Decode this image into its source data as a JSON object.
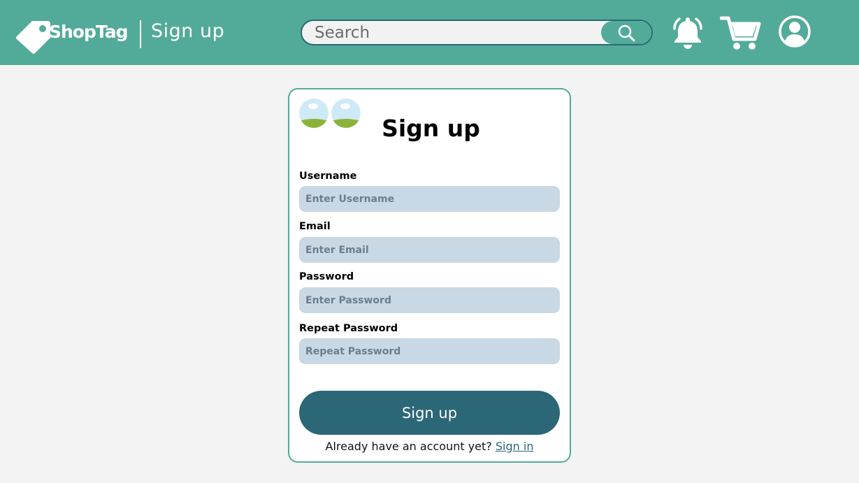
{
  "header": {
    "brand": "ShopTag",
    "page_label": "Sign up",
    "search": {
      "placeholder": "Search"
    },
    "icons": [
      "tag-logo-icon",
      "search-icon",
      "bell-icon",
      "cart-icon",
      "user-account-icon"
    ]
  },
  "form": {
    "title": "Sign up",
    "fields": [
      {
        "label": "Username",
        "placeholder": "Enter Username",
        "value": ""
      },
      {
        "label": "Email",
        "placeholder": "Enter Email",
        "value": ""
      },
      {
        "label": "Password",
        "placeholder": "Enter Password",
        "value": ""
      },
      {
        "label": "Repeat Password",
        "placeholder": "Repeat Password",
        "value": ""
      }
    ],
    "submit_label": "Sign up",
    "footer_text": "Already have an account yet?",
    "signin_link": "Sign in"
  },
  "colors": {
    "header_bg": "#52ab98",
    "accent_dark": "#2b6777",
    "input_bg": "#c8d8e4",
    "page_bg": "#f3f3f3",
    "card_border": "#52ab98"
  }
}
